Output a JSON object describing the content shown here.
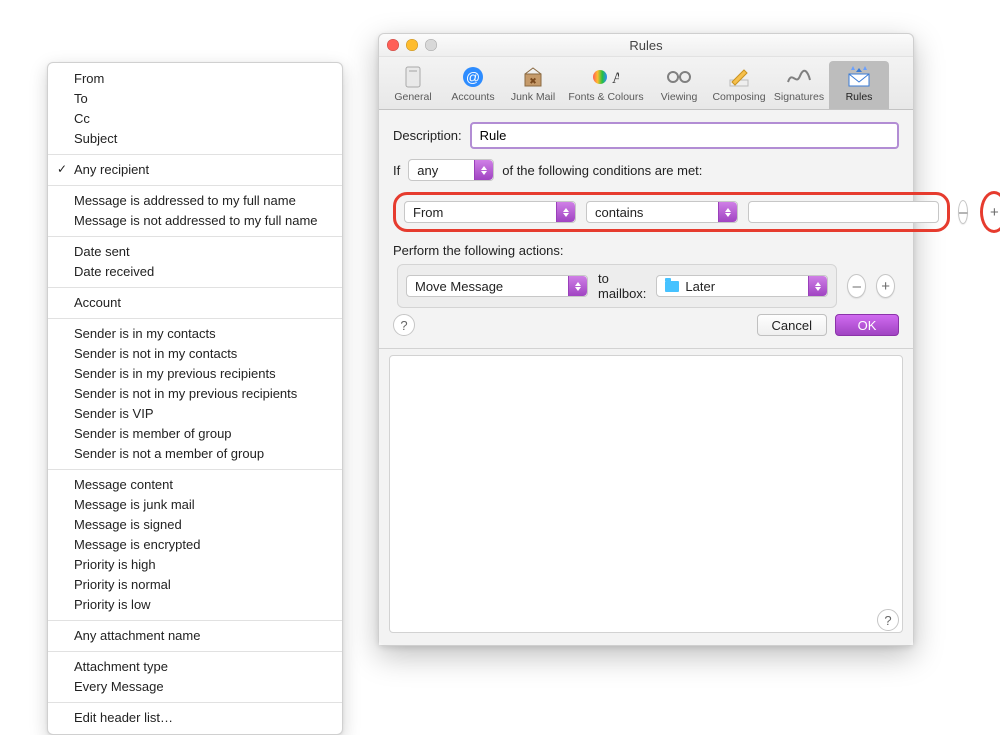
{
  "window": {
    "title": "Rules"
  },
  "toolbar": {
    "tabs": {
      "general": "General",
      "accounts": "Accounts",
      "junk": "Junk Mail",
      "fonts": "Fonts & Colours",
      "viewing": "Viewing",
      "composing": "Composing",
      "signatures": "Signatures",
      "rules": "Rules"
    }
  },
  "sheet": {
    "description_label": "Description:",
    "description_value": "Rule",
    "if_label": "If",
    "if_mode": "any",
    "if_suffix": "of the following conditions are met:",
    "cond_field": "From",
    "cond_op": "contains",
    "cond_value": "",
    "actions_label": "Perform the following actions:",
    "action_type": "Move Message",
    "action_mid": "to mailbox:",
    "action_target": "Later",
    "cancel": "Cancel",
    "ok": "OK",
    "minus": "–",
    "plus": "+",
    "help": "?"
  },
  "menu": {
    "g1": [
      "From",
      "To",
      "Cc",
      "Subject"
    ],
    "g2_selected": "Any recipient",
    "g3": [
      "Message is addressed to my full name",
      "Message is not addressed to my full name"
    ],
    "g4": [
      "Date sent",
      "Date received"
    ],
    "g5": [
      "Account"
    ],
    "g6": [
      "Sender is in my contacts",
      "Sender is not in my contacts",
      "Sender is in my previous recipients",
      "Sender is not in my previous recipients",
      "Sender is VIP",
      "Sender is member of group",
      "Sender is not a member of group"
    ],
    "g7": [
      "Message content",
      "Message is junk mail",
      "Message is signed",
      "Message is encrypted",
      "Priority is high",
      "Priority is normal",
      "Priority is low"
    ],
    "g8": [
      "Any attachment name"
    ],
    "g9": [
      "Attachment type",
      "Every Message"
    ],
    "g10": [
      "Edit header list…"
    ]
  }
}
